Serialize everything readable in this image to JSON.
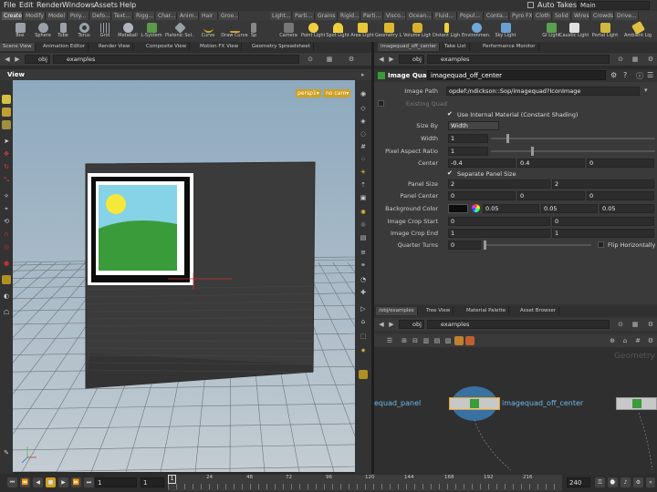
{
  "menubar": {
    "items": [
      "File",
      "Edit",
      "Render",
      "Windows",
      "Assets",
      "Help"
    ],
    "auto_takes": "Auto Takes",
    "desktop": "Main"
  },
  "shelf_tabs_left": [
    "Create",
    "Modify",
    "Model",
    "Poly...",
    "Defo...",
    "Text...",
    "Rigg...",
    "Char...",
    "Anim...",
    "Hair",
    "Groo..."
  ],
  "shelf_tabs_right": [
    "Light...",
    "Parti...",
    "Grains",
    "Rigid...",
    "Parti...",
    "Visco...",
    "Ocean...",
    "Fluid...",
    "Popul...",
    "Conta...",
    "Pyro FX",
    "Cloth",
    "Solid",
    "Wires",
    "Crowds",
    "Drive..."
  ],
  "shelf_tools_left": [
    "Box",
    "Sphere",
    "Tube",
    "Torus",
    "Grid",
    "Metaball",
    "L-System",
    "Platonic Sol...",
    "Curve",
    "Draw Curve",
    "Sp"
  ],
  "shelf_tools_right": [
    "Camera",
    "Point Light",
    "Spot Light",
    "Area Light",
    "Geometry L...",
    "Volume Light",
    "Distant Light",
    "Environmen...",
    "Sky Light",
    "GI Light",
    "Caustic Light",
    "Portal Light",
    "Ambient Lig"
  ],
  "pane_tabs_left": [
    "Scene View",
    "Animation Editor",
    "Render View",
    "Composite View",
    "Motion FX View",
    "Geometry Spreadsheet"
  ],
  "pane_tabs_right": [
    "imagequad_off_center",
    "Take List",
    "Performance Monitor"
  ],
  "viewer": {
    "context": "obj",
    "path": "examples",
    "title": "View",
    "camera_menu": "persp1▾",
    "cam_menu": "no cam▾"
  },
  "params": {
    "context": "obj",
    "path": "examples",
    "node_type": "Image Quad",
    "node_name": "imagequad_off_center",
    "image_path_label": "Image Path",
    "image_path": "opdef:/ndickson::Sop/imagequad?IconImage",
    "existing_quad": "Existing Quad",
    "use_internal": "Use Internal Material (Constant Shading)",
    "size_by_label": "Size By",
    "size_by": "Width",
    "width_label": "Width",
    "width": "1",
    "par_label": "Pixel Aspect Ratio",
    "par": "1",
    "center_label": "Center",
    "center": [
      "-0.4",
      "0.4",
      "0"
    ],
    "separate_label": "Separate Panel Size",
    "panel_size_label": "Panel Size",
    "panel_size": [
      "2",
      "2"
    ],
    "panel_center_label": "Panel Center",
    "panel_center": [
      "0",
      "0",
      "0"
    ],
    "bg_color_label": "Background Color",
    "bg_color": [
      "0.05",
      "0.05",
      "0.05"
    ],
    "crop_start_label": "Image Crop Start",
    "crop_start": [
      "0",
      "0"
    ],
    "crop_end_label": "Image Crop End",
    "crop_end": [
      "1",
      "1"
    ],
    "quarter_label": "Quarter Turns",
    "quarter": "0",
    "flip_label": "Flip Horizontally"
  },
  "net_tabs": [
    "/obj/examples",
    "Tree View",
    "Material Palette",
    "Asset Browser"
  ],
  "network": {
    "context": "obj",
    "path": "examples",
    "watermark": "Geometry",
    "left_node": "equad_panel",
    "center_node": "imagequad_off_center"
  },
  "timeline": {
    "frame": "1",
    "start": "1",
    "start2": "1",
    "ticks": [
      "1",
      "24",
      "48",
      "72",
      "96",
      "120",
      "144",
      "168",
      "192",
      "216"
    ],
    "end": "240",
    "end2": "240"
  },
  "colors": {
    "accent": "#e8a317",
    "selected_node": "#3b8fd4",
    "viewport_sky_top": "#8ea9be",
    "viewport_sky_bottom": "#c3ccd2",
    "image_sky": "#86d2e6",
    "image_grass": "#3a9b3a",
    "image_sun": "#f5e83a"
  }
}
